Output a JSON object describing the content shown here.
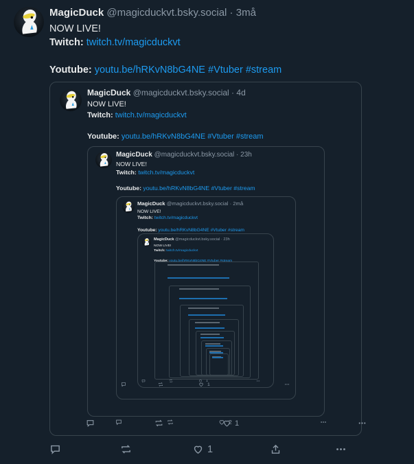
{
  "posts": [
    {
      "name": "MagicDuck",
      "handle": "@magicduckvt.bsky.social",
      "time": "3må",
      "live": "NOW LIVE!",
      "twitch_label": "Twitch:",
      "twitch_link": "twitch.tv/magicduckvt",
      "youtube_label": "Youtube:",
      "youtube_link": "youtu.be/hRKvN8bG4NE",
      "tags": "#Vtuber #stream",
      "likes": "1"
    },
    {
      "name": "MagicDuck",
      "handle": "@magicduckvt.bsky.social",
      "time": "4d",
      "live": "NOW LIVE!",
      "twitch_label": "Twitch:",
      "twitch_link": "twitch.tv/magicduckvt",
      "youtube_label": "Youtube:",
      "youtube_link": "youtu.be/hRKvN8bG4NE",
      "tags": "#Vtuber #stream",
      "likes": "1"
    },
    {
      "name": "MagicDuck",
      "handle": "@magicduckvt.bsky.social",
      "time": "23h",
      "live": "NOW LIVE!",
      "twitch_label": "Twitch:",
      "twitch_link": "twitch.tv/magicduckvt",
      "youtube_label": "Youtube:",
      "youtube_link": "youtu.be/hRKvN8bG4NE",
      "tags": "#Vtuber #stream",
      "likes": "2"
    },
    {
      "name": "MagicDuck",
      "handle": "@magicduckvt.bsky.social",
      "time": "2må",
      "live": "NOW LIVE!",
      "twitch_label": "Twitch:",
      "twitch_link": "twitch.tv/magicduckvt",
      "youtube_label": "Youtube:",
      "youtube_link": "youtu.be/hRKvN8bG4NE",
      "tags": "#Vtuber #stream",
      "likes": "1"
    },
    {
      "name": "MagicDuck",
      "handle": "@magicduckvt.bsky.social",
      "time": "23h",
      "live": "NOW LIVE!",
      "twitch_label": "Twitch:",
      "twitch_link": "twitch.tv/magicduckvt",
      "youtube_label": "Youtube:",
      "youtube_link": "youtu.be/hRKvN8bG4NE",
      "tags": "#Vtuber #stream",
      "likes": "1"
    }
  ],
  "icons": {
    "reply": "reply-icon",
    "repost": "repost-icon",
    "like": "heart-icon",
    "share": "share-icon",
    "more": "more-options-icon",
    "avatar": "duck-avatar-icon"
  },
  "colors": {
    "background": "#15202b",
    "text": "#e7e9ea",
    "muted": "#8b98a5",
    "link": "#1d9bf0",
    "border": "#38444d"
  }
}
